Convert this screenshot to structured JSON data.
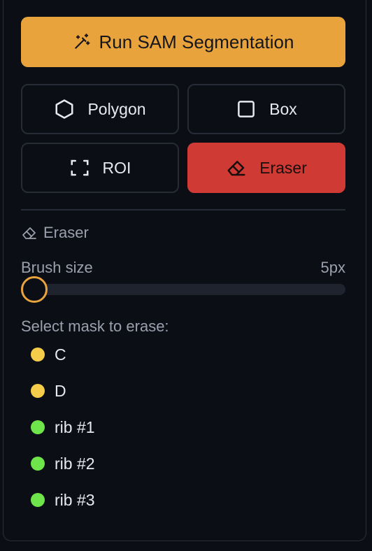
{
  "run_button": {
    "label": "Run SAM Segmentation",
    "icon": "magic-wand-icon"
  },
  "tools": [
    {
      "label": "Polygon",
      "icon": "hexagon-icon",
      "active": false
    },
    {
      "label": "Box",
      "icon": "square-icon",
      "active": false
    },
    {
      "label": "ROI",
      "icon": "focus-frame-icon",
      "active": false
    },
    {
      "label": "Eraser",
      "icon": "eraser-icon",
      "active": true
    }
  ],
  "eraser_section": {
    "title": "Eraser",
    "brush_label": "Brush size",
    "brush_value": "5px",
    "brush_level": 0,
    "mask_prompt": "Select mask to erase:"
  },
  "masks": [
    {
      "label": "C",
      "color": "#f6cd4a"
    },
    {
      "label": "D",
      "color": "#f6cd4a"
    },
    {
      "label": "rib #1",
      "color": "#6ee64b"
    },
    {
      "label": "rib #2",
      "color": "#6ee64b"
    },
    {
      "label": "rib #3",
      "color": "#6ee64b"
    }
  ],
  "colors": {
    "accent": "#e9a33c",
    "active_tool": "#cf3b34",
    "background": "#0b0e15"
  }
}
